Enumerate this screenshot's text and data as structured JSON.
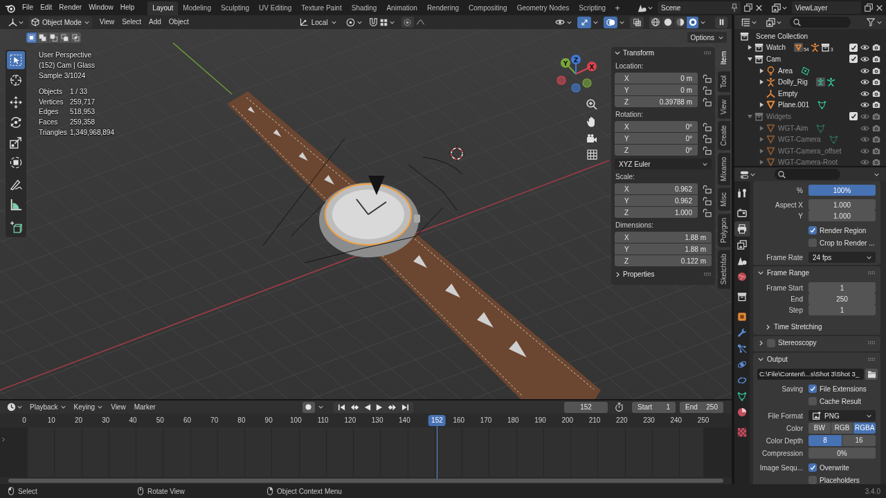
{
  "topbar": {
    "menus": [
      "File",
      "Edit",
      "Render",
      "Window",
      "Help"
    ],
    "workspaces": [
      {
        "label": "Layout",
        "selected": true
      },
      {
        "label": "Modeling",
        "selected": false
      },
      {
        "label": "Sculpting",
        "selected": false
      },
      {
        "label": "UV Editing",
        "selected": false
      },
      {
        "label": "Texture Paint",
        "selected": false
      },
      {
        "label": "Shading",
        "selected": false
      },
      {
        "label": "Animation",
        "selected": false
      },
      {
        "label": "Rendering",
        "selected": false
      },
      {
        "label": "Compositing",
        "selected": false
      },
      {
        "label": "Geometry Nodes",
        "selected": false
      },
      {
        "label": "Scripting",
        "selected": false
      }
    ],
    "add_workspace": "+",
    "scene": "Scene",
    "view_layer": "ViewLayer"
  },
  "viewport": {
    "header": {
      "mode": "Object Mode",
      "menus": [
        "View",
        "Select",
        "Add",
        "Object"
      ],
      "orientation": "Local",
      "toggles": [
        {
          "kind": "gizmos",
          "on": true
        },
        {
          "kind": "overlays",
          "on": true
        },
        {
          "kind": "xray",
          "on": false
        }
      ],
      "shading": [
        {
          "kind": "wireframe",
          "selected": false
        },
        {
          "kind": "solid",
          "selected": false
        },
        {
          "kind": "material",
          "selected": false
        },
        {
          "kind": "rendered",
          "selected": true
        }
      ]
    },
    "selection_modes": [
      {
        "kind": "set",
        "selected": true
      },
      {
        "kind": "extend",
        "selected": false
      },
      {
        "kind": "subtract",
        "selected": false
      },
      {
        "kind": "difference",
        "selected": false
      },
      {
        "kind": "intersect",
        "selected": false
      }
    ],
    "options": "Options",
    "tool_groups": [
      [
        {
          "kind": "select_box",
          "selected": true
        },
        {
          "kind": "cursor",
          "selected": false
        }
      ],
      [
        {
          "kind": "move",
          "selected": false
        },
        {
          "kind": "rotate",
          "selected": false
        },
        {
          "kind": "scale",
          "selected": false
        },
        {
          "kind": "transform",
          "selected": false
        }
      ],
      [
        {
          "kind": "annotate",
          "selected": false
        },
        {
          "kind": "measure",
          "selected": false
        }
      ],
      [
        {
          "kind": "add_cube",
          "selected": false
        }
      ]
    ],
    "info": [
      "User Perspective",
      "(152) Cam | Glass",
      "Sample 3/1024"
    ],
    "stats": [
      {
        "label": "Objects",
        "value": "1 / 33"
      },
      {
        "label": "Vertices",
        "value": "259,717"
      },
      {
        "label": "Edges",
        "value": "518,953"
      },
      {
        "label": "Faces",
        "value": "259,358"
      },
      {
        "label": "Triangles",
        "value": "1,349,968,894"
      }
    ],
    "gizmo_axes": [
      {
        "label": "X",
        "color": "#d9434e"
      },
      {
        "label": "Y",
        "color": "#7aa83a"
      },
      {
        "label": "Z",
        "color": "#4079d6"
      }
    ],
    "sidebar": {
      "panels": [
        {
          "title": "Transform",
          "expanded": true,
          "items": [
            {
              "kind": "vector",
              "label": "Location:",
              "rows": [
                {
                  "axis": "X",
                  "value": "0 m",
                  "locked": false
                },
                {
                  "axis": "Y",
                  "value": "0 m",
                  "locked": false
                },
                {
                  "axis": "Z",
                  "value": "0.39788 m",
                  "locked": false
                }
              ]
            },
            {
              "kind": "vector",
              "label": "Rotation:",
              "rows": [
                {
                  "axis": "X",
                  "value": "0°",
                  "locked": false
                },
                {
                  "axis": "Y",
                  "value": "0°",
                  "locked": false
                },
                {
                  "axis": "Z",
                  "value": "0°",
                  "locked": false
                }
              ]
            },
            {
              "kind": "dropdown",
              "value": "XYZ Euler"
            },
            {
              "kind": "vector",
              "label": "Scale:",
              "rows": [
                {
                  "axis": "X",
                  "value": "0.962",
                  "locked": false
                },
                {
                  "axis": "Y",
                  "value": "0.962",
                  "locked": false
                },
                {
                  "axis": "Z",
                  "value": "1.000",
                  "locked": false
                }
              ]
            },
            {
              "kind": "vector",
              "label": "Dimensions:",
              "rows": [
                {
                  "axis": "X",
                  "value": "1.88 m"
                },
                {
                  "axis": "Y",
                  "value": "1.88 m"
                },
                {
                  "axis": "Z",
                  "value": "0.122 m"
                }
              ]
            }
          ]
        },
        {
          "title": "Properties",
          "expanded": false
        }
      ],
      "tabs": [
        {
          "label": "Item",
          "selected": true
        },
        {
          "label": "Tool",
          "selected": false
        },
        {
          "label": "View",
          "selected": false
        },
        {
          "label": "Create",
          "selected": false
        },
        {
          "label": "Mixamo",
          "selected": false
        },
        {
          "label": "Misc",
          "selected": false
        },
        {
          "label": "Polygon",
          "selected": false
        },
        {
          "label": "Sketchfab",
          "selected": false
        }
      ]
    }
  },
  "timeline": {
    "menus": [
      {
        "kind": "popover",
        "label": "Playback"
      },
      {
        "kind": "popover",
        "label": "Keying"
      },
      {
        "kind": "menu",
        "label": "View"
      },
      {
        "kind": "menu",
        "label": "Marker"
      }
    ],
    "auto_keying": false,
    "controls": [
      {
        "kind": "jump_start"
      },
      {
        "kind": "prev_key"
      },
      {
        "kind": "play_reverse"
      },
      {
        "kind": "play"
      },
      {
        "kind": "next_key"
      },
      {
        "kind": "jump_end"
      }
    ],
    "current_frame": "152",
    "start_label": "Start",
    "start": "1",
    "end_label": "End",
    "end": "250",
    "ticks": [
      "0",
      "10",
      "20",
      "30",
      "40",
      "50",
      "60",
      "70",
      "80",
      "90",
      "100",
      "110",
      "120",
      "130",
      "140",
      "160",
      "170",
      "180",
      "190",
      "200",
      "210",
      "220",
      "230",
      "240",
      "250"
    ],
    "playhead": "152"
  },
  "outliner": {
    "root": "Scene Collection",
    "items": [
      {
        "name": "Watch",
        "kind": "collection",
        "expanded": false,
        "checked": true,
        "dimmed": false,
        "badges": [
          {
            "kind": "mesh",
            "count": "54"
          },
          {
            "kind": "armature"
          },
          {
            "kind": "collection",
            "count": "3"
          }
        ]
      },
      {
        "name": "Cam",
        "kind": "collection",
        "expanded": true,
        "checked": true,
        "dimmed": false,
        "children": [
          {
            "name": "Area",
            "kind": "light",
            "expanded": false,
            "dimmed": false,
            "badges": [
              {
                "kind": "light_data"
              }
            ]
          },
          {
            "name": "Dolly_Rig",
            "kind": "armature",
            "expanded": false,
            "dimmed": false,
            "badges": [
              {
                "kind": "pose"
              },
              {
                "kind": "armature_data"
              }
            ]
          },
          {
            "name": "Empty",
            "kind": "empty",
            "dimmed": false
          },
          {
            "name": "Plane.001",
            "kind": "mesh",
            "expanded": false,
            "dimmed": false,
            "badges": [
              {
                "kind": "mesh_data"
              }
            ]
          }
        ]
      },
      {
        "name": "Widgets",
        "kind": "collection",
        "expanded": true,
        "checked": true,
        "dimmed": true,
        "children": [
          {
            "name": "WGT-Aim",
            "kind": "mesh",
            "expanded": false,
            "dimmed": true,
            "badges": [
              {
                "kind": "mesh_data"
              }
            ]
          },
          {
            "name": "WGT-Camera",
            "kind": "mesh",
            "expanded": false,
            "dimmed": true,
            "badges": [
              {
                "kind": "mesh_data"
              }
            ]
          },
          {
            "name": "WGT-Camera_offset",
            "kind": "mesh",
            "expanded": false,
            "dimmed": true
          },
          {
            "name": "WGT-Camera-Root",
            "kind": "mesh",
            "expanded": false,
            "dimmed": true
          }
        ]
      }
    ]
  },
  "properties": {
    "tab_groups": [
      [
        {
          "kind": "tool",
          "selected": false
        }
      ],
      [
        {
          "kind": "render",
          "selected": false
        },
        {
          "kind": "output",
          "selected": true
        },
        {
          "kind": "view_layer",
          "selected": false
        },
        {
          "kind": "scene",
          "selected": false
        },
        {
          "kind": "world",
          "selected": false
        }
      ],
      [
        {
          "kind": "collection",
          "selected": false
        }
      ],
      [
        {
          "kind": "object",
          "selected": false
        },
        {
          "kind": "modifiers",
          "selected": false
        },
        {
          "kind": "particles",
          "selected": false
        },
        {
          "kind": "physics",
          "selected": false
        },
        {
          "kind": "constraints",
          "selected": false
        },
        {
          "kind": "data",
          "selected": false
        },
        {
          "kind": "material",
          "selected": false
        }
      ],
      [
        {
          "kind": "texture",
          "selected": false
        }
      ]
    ],
    "sections": [
      {
        "rows": [
          {
            "kind": "slider",
            "label": "%",
            "value": "100%",
            "level": 1
          },
          {
            "kind": "number",
            "label": "Aspect X",
            "value": "1.000"
          },
          {
            "kind": "number",
            "label": "Y",
            "value": "1.000"
          },
          {
            "kind": "checkbox",
            "text": "Render Region",
            "checked": true
          },
          {
            "kind": "checkbox",
            "text": "Crop to Render ...",
            "checked": false
          },
          {
            "kind": "dropdown",
            "label": "Frame Rate",
            "value": "24 fps"
          }
        ]
      },
      {
        "title": "Frame Range",
        "expanded": true,
        "rows": [
          {
            "kind": "number",
            "label": "Frame Start",
            "value": "1"
          },
          {
            "kind": "number",
            "label": "End",
            "value": "250"
          },
          {
            "kind": "number",
            "label": "Step",
            "value": "1"
          },
          {
            "kind": "subpanel",
            "title": "Time Stretching",
            "expanded": false
          }
        ]
      },
      {
        "title": "Stereoscopy",
        "expanded": false,
        "checkbox": false
      },
      {
        "title": "Output",
        "expanded": true,
        "rows": [
          {
            "kind": "path",
            "value": "C:\\File\\Content\\...s\\Shot 3\\Shot 3_"
          },
          {
            "kind": "checkbox",
            "label": "Saving",
            "text": "File Extensions",
            "checked": true
          },
          {
            "kind": "checkbox",
            "text": "Cache Result",
            "checked": false
          },
          {
            "kind": "image_dropdown",
            "label": "File Format",
            "value": "PNG"
          },
          {
            "kind": "segmented",
            "label": "Color",
            "options": [
              {
                "label": "BW",
                "selected": false
              },
              {
                "label": "RGB",
                "selected": false
              },
              {
                "label": "RGBA",
                "selected": true
              }
            ]
          },
          {
            "kind": "segmented",
            "label": "Color Depth",
            "options": [
              {
                "label": "8",
                "selected": true
              },
              {
                "label": "16",
                "selected": false
              }
            ]
          },
          {
            "kind": "number",
            "label": "Compression",
            "value": "0%"
          },
          {
            "kind": "checkbox",
            "label": "Image Sequ...",
            "text": "Overwrite",
            "checked": true
          },
          {
            "kind": "checkbox",
            "text": "Placeholders",
            "checked": false
          }
        ]
      }
    ]
  },
  "status_bar": {
    "hints": [
      {
        "kind": "mouse_left",
        "label": "Select"
      },
      {
        "kind": "mouse_middle",
        "label": "Rotate View"
      },
      {
        "kind": "mouse_right",
        "label": "Object Context Menu"
      }
    ],
    "version": "3.4.0"
  }
}
